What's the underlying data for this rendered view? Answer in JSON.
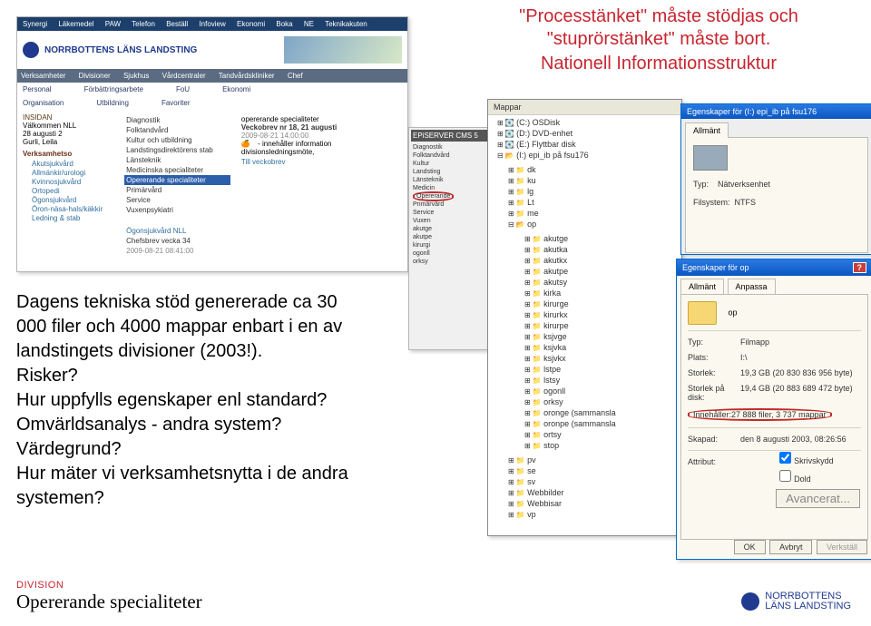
{
  "quote": {
    "line1": "\"Processtänket\" måste stödjas och \"stuprörstänket\" måste bort.",
    "line2": "Nationell Informationsstruktur"
  },
  "intranet": {
    "topmenu": [
      "Synergi",
      "Läkemedel",
      "PAW",
      "Telefon",
      "Beställ",
      "Infoview",
      "Ekonomi",
      "Boka",
      "NE",
      "Teknikakuten"
    ],
    "orgname": "NORRBOTTENS LÄNS LANDSTING",
    "menubar": [
      "Verksamheter",
      "Divisioner",
      "Sjukhus",
      "Vårdcentraler",
      "Tandvårdskliniker",
      "Chef"
    ],
    "subrow_left": [
      "Personal",
      "Organisation"
    ],
    "subrow_mid": [
      "Förbättringsarbete",
      "Utbildning"
    ],
    "subrow_right": [
      "FoU",
      "Ekonomi",
      "Favoriter"
    ],
    "leftcol": {
      "insidan_label": "INSIDAN",
      "welcome": "Välkommen NLL",
      "date": "28 augusti 2",
      "user": "Gurli, Leila",
      "section_label": "Verksamhetso",
      "items": [
        "Akutsjukvård",
        "Allmänkir/urologi",
        "Kvinnosjukvård",
        "Ortopedi",
        "Ögonsjukvård",
        "Öron-näsa-hals/käkkir",
        "Ledning & stab"
      ]
    },
    "midcol": [
      "Diagnostik",
      "Folktandvård",
      "Kultur och utbildning",
      "Landstingsdirektörens stab",
      "Länsteknik",
      "Medicinska specialiteter",
      "Opererande specialiteter",
      "Primärvård",
      "Service",
      "Vuxenpsykiatri"
    ],
    "mid_bottom": {
      "l1": "Ögonsjukvård NLL",
      "l2": "Chefsbrev vecka 34",
      "l3": "2009-08-21 08:41:00"
    },
    "news": {
      "unit": "opererande specialiteter",
      "h": "Veckobrev nr 18, 21 augusti",
      "ts": "2009-08-21 14:00:00",
      "body": "- innehåller information divisionsledningsmöte,",
      "link": "Till veckobrev"
    }
  },
  "epi": {
    "brand": "EPiSERVER CMS 5",
    "items": [
      "Diagnostik",
      "Folktandvård",
      "Kultur",
      "Landsting",
      "Länsteknik",
      "Medicin",
      "Opererande",
      "Primärvård",
      "Service",
      "Vuxen",
      "akutge",
      "akutpe",
      "kirurgi",
      "ogonll",
      "orksy"
    ]
  },
  "mappar": {
    "title": "Mappar",
    "drives": [
      "(C:) OSDisk",
      "(D:) DVD-enhet",
      "(E:) Flyttbar disk",
      "(I:) epi_ib på fsu176"
    ],
    "lvl1": [
      "dk",
      "ku",
      "lg",
      "Lt",
      "me",
      "op"
    ],
    "lvl2": [
      "akutge",
      "akutka",
      "akutkx",
      "akutpe",
      "akutsy",
      "kirka",
      "kirurge",
      "kirurkx",
      "kirurpe",
      "ksjvge",
      "ksjvka",
      "ksjvkx",
      "lstpe",
      "lstsy",
      "ogonll",
      "orksy",
      "oronge (sammansla",
      "oronpe (sammansla",
      "ortsy",
      "stop"
    ],
    "lvl1b": [
      "pv",
      "se",
      "sv",
      "Webbilder",
      "Webbisar",
      "vp"
    ]
  },
  "props1": {
    "title": "Egenskaper för (I:) epi_ib på fsu176",
    "tab": "Allmänt",
    "typ_k": "Typ:",
    "typ_v": "Nätverksenhet",
    "fs_k": "Filsystem:",
    "fs_v": "NTFS"
  },
  "props2": {
    "title": "Egenskaper för op",
    "tabs": [
      "Allmänt",
      "Anpassa"
    ],
    "name": "op",
    "rows": {
      "typ_k": "Typ:",
      "typ_v": "Filmapp",
      "plats_k": "Plats:",
      "plats_v": "I:\\",
      "stor_k": "Storlek:",
      "stor_v": "19,3 GB (20 830 836 956 byte)",
      "disk_k": "Storlek på disk:",
      "disk_v": "19,4 GB (20 883 689 472 byte)",
      "inn_k": "Innehåller:",
      "inn_v": "27 888 filer, 3 737 mappar",
      "skap_k": "Skapad:",
      "skap_v": "den 8 augusti 2003, 08:26:56",
      "attr_k": "Attribut:",
      "attr1": "Skrivskydd",
      "attr2": "Dold",
      "btn_adv": "Avancerat...",
      "ok": "OK",
      "avbryt": "Avbryt",
      "verk": "Verkställ"
    }
  },
  "bullets": {
    "l1": "Dagens tekniska stöd genererade ca 30 000 filer och 4000 mappar enbart i en av landstingets divisioner (2003!).",
    "l2": "Risker?",
    "l3": "Hur uppfylls egenskaper enl standard?",
    "l4": "Omvärldsanalys - andra system?",
    "l5": "Värdegrund?",
    "l6": "Hur mäter vi verksamhetsnytta i de andra systemen?"
  },
  "footer": {
    "division": "DIVISION",
    "unit": "Opererande specialiteter",
    "brand1": "NORRBOTTENS",
    "brand2": "LÄNS LANDSTING"
  }
}
